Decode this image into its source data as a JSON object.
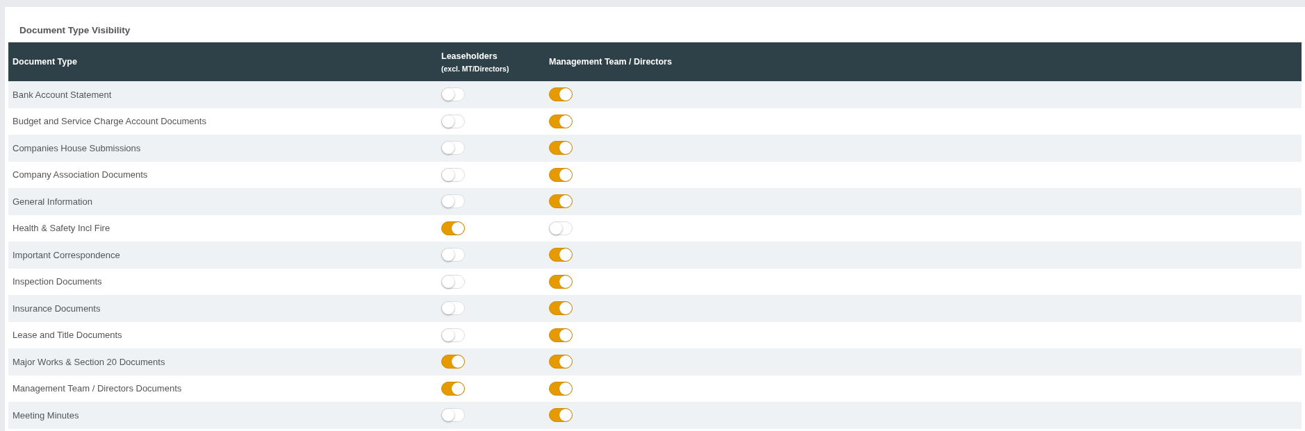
{
  "section": {
    "title": "Document Type Visibility"
  },
  "table": {
    "columns": [
      {
        "label": "Document Type"
      },
      {
        "label": "Leaseholders",
        "sublabel": "(excl. MT/Directors)"
      },
      {
        "label": "Management Team / Directors"
      }
    ],
    "rows": [
      {
        "document_type": "Bank Account Statement",
        "leaseholders_on": false,
        "management_on": true
      },
      {
        "document_type": "Budget and Service Charge Account Documents",
        "leaseholders_on": false,
        "management_on": true
      },
      {
        "document_type": "Companies House Submissions",
        "leaseholders_on": false,
        "management_on": true
      },
      {
        "document_type": "Company Association Documents",
        "leaseholders_on": false,
        "management_on": true
      },
      {
        "document_type": "General Information",
        "leaseholders_on": false,
        "management_on": true
      },
      {
        "document_type": "Health & Safety Incl Fire",
        "leaseholders_on": true,
        "management_on": false
      },
      {
        "document_type": "Important Correspondence",
        "leaseholders_on": false,
        "management_on": true
      },
      {
        "document_type": "Inspection Documents",
        "leaseholders_on": false,
        "management_on": true
      },
      {
        "document_type": "Insurance Documents",
        "leaseholders_on": false,
        "management_on": true
      },
      {
        "document_type": "Lease and Title Documents",
        "leaseholders_on": false,
        "management_on": true
      },
      {
        "document_type": "Major Works & Section 20 Documents",
        "leaseholders_on": true,
        "management_on": true
      },
      {
        "document_type": "Management Team / Directors Documents",
        "leaseholders_on": true,
        "management_on": true
      },
      {
        "document_type": "Meeting Minutes",
        "leaseholders_on": false,
        "management_on": true
      }
    ]
  }
}
